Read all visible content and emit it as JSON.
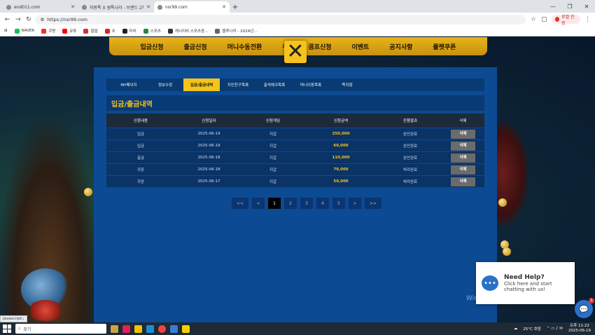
{
  "browser": {
    "tabs": [
      {
        "title": "end011.com",
        "active": false
      },
      {
        "title": "자몽톡 X 썸톡나라 - 브랜드 2차",
        "active": false
      },
      {
        "title": "nsr99.com",
        "active": true
      }
    ],
    "url": "https://nsr99.com",
    "profile_label": "로컬 인증",
    "bookmarks": [
      "NAVER",
      "쿠팡",
      "유튜",
      "멀멀",
      "초",
      "티비",
      "스포츠",
      "케시티비 스포츠중...",
      "블루나라 - 2024년..."
    ]
  },
  "topnav": {
    "items": [
      "입금신청",
      "출금신청",
      "머니수동전환",
      "쿠",
      "콤프신청",
      "이벤트",
      "공지사항",
      "룰렛쿠폰"
    ],
    "close_glyph": "✕"
  },
  "subnav": {
    "items": [
      "MY페이지",
      "정보수정",
      "입금/출금내역",
      "지인친구목록",
      "출석체크목록",
      "머니이동목록",
      "쪽지함"
    ],
    "active_index": 2
  },
  "section_title": "입금/출금내역",
  "table": {
    "headers": [
      "신청내용",
      "신청일자",
      "신청게임",
      "신청금액",
      "진행결과",
      "삭제"
    ],
    "rows": [
      {
        "type": "입금",
        "date": "2025-06-19",
        "game": "지갑",
        "amount": "250,000",
        "result": "승인완료",
        "action": "삭제"
      },
      {
        "type": "입금",
        "date": "2025-06-19",
        "game": "지갑",
        "amount": "60,000",
        "result": "승인완료",
        "action": "삭제"
      },
      {
        "type": "출금",
        "date": "2025-06-18",
        "game": "지갑",
        "amount": "110,000",
        "result": "승인완료",
        "action": "삭제"
      },
      {
        "type": "쿠폰",
        "date": "2025-06-18",
        "game": "지갑",
        "amount": "70,000",
        "result": "처리완료",
        "action": "삭제"
      },
      {
        "type": "쿠폰",
        "date": "2025-06-17",
        "game": "지갑",
        "amount": "50,000",
        "result": "처리완료",
        "action": "삭제"
      }
    ]
  },
  "pager": {
    "first": "<<",
    "prev": "<",
    "pages": [
      "1",
      "2",
      "3",
      "4",
      "5"
    ],
    "next": ">",
    "last": ">>",
    "current": "1"
  },
  "chat": {
    "title": "Need Help?",
    "line1": "Click here and start",
    "line2": "chatting with us!",
    "badge": "1",
    "watermark": "Windows 정품 인증"
  },
  "status_text": "javascript:;",
  "taskbar": {
    "search_placeholder": "찾기",
    "weather": "25°C 흐림",
    "time": "오후 11:22",
    "date": "2025-06-19"
  },
  "colors": {
    "accent": "#f6c21c",
    "panel": "#0c4a93",
    "row": "#0a3366"
  }
}
